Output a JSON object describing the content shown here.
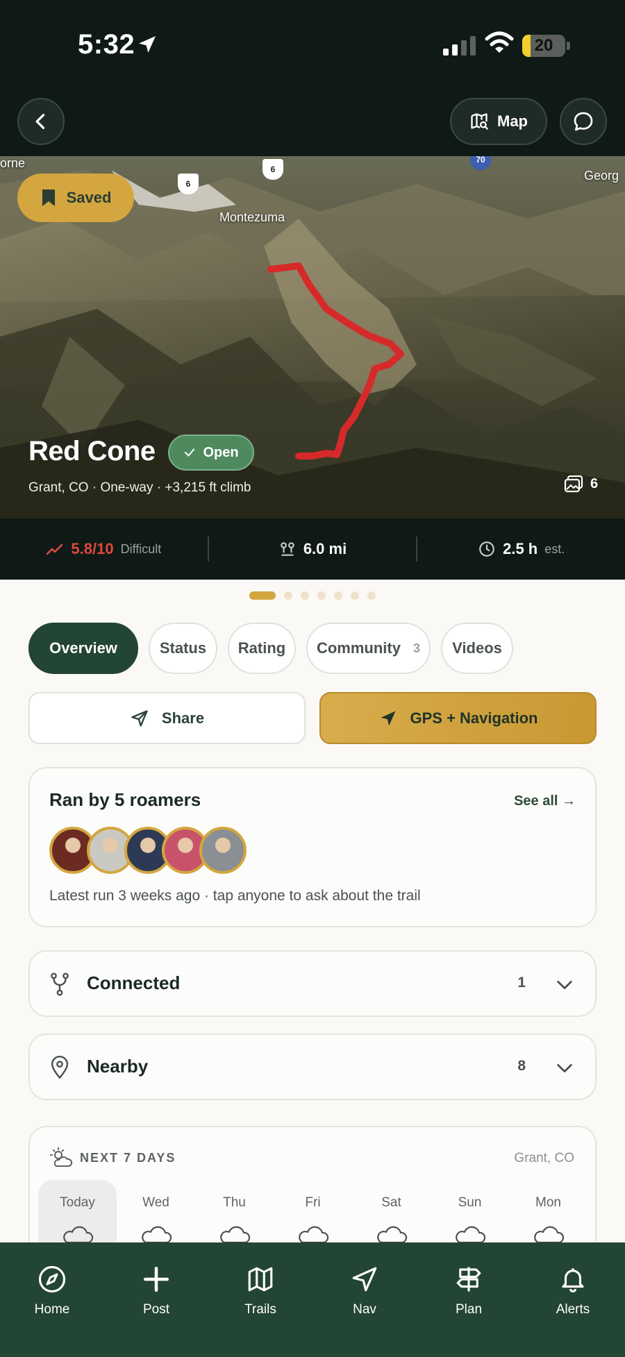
{
  "status_bar": {
    "time": "5:32",
    "battery": "20",
    "battery_level": 0.2
  },
  "header": {
    "map_label": "Map"
  },
  "hero": {
    "saved_label": "Saved",
    "map_labels": [
      "orne",
      "Montezuma",
      "Georg"
    ],
    "shields": [
      "6",
      "6",
      "70"
    ],
    "title": "Red Cone",
    "status_badge": "Open",
    "subtitle": "Grant, CO · One-way · +3,215 ft climb",
    "photo_count": "6"
  },
  "stats": {
    "difficulty_value": "5.8/10",
    "difficulty_label": "Difficult",
    "distance": "6.0 mi",
    "duration": "2.5 h",
    "duration_suffix": "est."
  },
  "carousel": {
    "total": 7,
    "active_index": 0
  },
  "tabs": [
    {
      "label": "Overview",
      "active": true
    },
    {
      "label": "Status"
    },
    {
      "label": "Rating"
    },
    {
      "label": "Community",
      "count": "3"
    },
    {
      "label": "Videos"
    }
  ],
  "actions": {
    "share_label": "Share",
    "gps_label": "GPS + Navigation"
  },
  "roamers": {
    "title": "Ran by 5 roamers",
    "see_all": "See all →",
    "note": "Latest run 3 weeks ago · tap anyone to ask about the trail",
    "avatar_colors": [
      "#6b2a22",
      "#c9c9c2",
      "#2d3a55",
      "#c8526a",
      "#8a8f94"
    ]
  },
  "connected": {
    "label": "Connected",
    "count": "1"
  },
  "nearby": {
    "label": "Nearby",
    "count": "8"
  },
  "weather": {
    "heading": "NEXT 7 DAYS",
    "location": "Grant, CO",
    "days": [
      "Today",
      "Wed",
      "Thu",
      "Fri",
      "Sat",
      "Sun",
      "Mon"
    ]
  },
  "nav": [
    {
      "label": "Home",
      "icon": "compass-icon"
    },
    {
      "label": "Post",
      "icon": "plus-icon"
    },
    {
      "label": "Trails",
      "icon": "map-icon"
    },
    {
      "label": "Nav",
      "icon": "navigation-icon"
    },
    {
      "label": "Plan",
      "icon": "signpost-icon"
    },
    {
      "label": "Alerts",
      "icon": "bell-icon"
    }
  ],
  "colors": {
    "accent": "#d4a63f",
    "dark_green": "#234533",
    "difficulty_red": "#e0473f",
    "open_green": "#4f8a5f"
  }
}
